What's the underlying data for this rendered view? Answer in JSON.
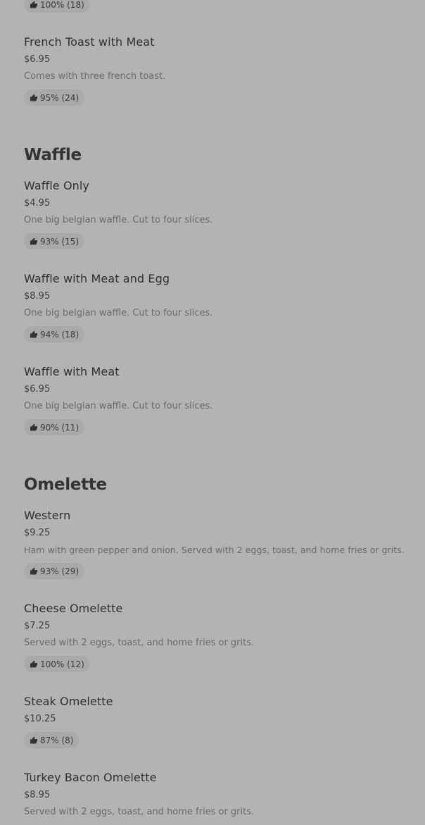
{
  "colors": {
    "background": "#b3b3b3",
    "badge": "#a9a9a9",
    "text": "#2f2f2f",
    "muted": "#6a6a6a"
  },
  "icon": "thumbs-up-icon",
  "top_badge": "100% (18)",
  "items": {
    "french_toast_meat": {
      "name": "French Toast with Meat",
      "price": "$6.95",
      "desc": "Comes with three french toast.",
      "rating": "95% (24)"
    },
    "waffle_only": {
      "name": "Waffle Only",
      "price": "$4.95",
      "desc": "One big belgian waffle. Cut to four slices.",
      "rating": "93% (15)"
    },
    "waffle_meat_egg": {
      "name": "Waffle with Meat and Egg",
      "price": "$8.95",
      "desc": "One big belgian waffle. Cut to four slices.",
      "rating": "94% (18)"
    },
    "waffle_meat": {
      "name": "Waffle with Meat",
      "price": "$6.95",
      "desc": "One big belgian waffle. Cut to four slices.",
      "rating": "90% (11)"
    },
    "western": {
      "name": "Western",
      "price": "$9.25",
      "desc": "Ham with green pepper and onion. Served with 2 eggs, toast, and home fries or grits.",
      "rating": "93% (29)"
    },
    "cheese_omelette": {
      "name": "Cheese Omelette",
      "price": "$7.25",
      "desc": "Served with 2 eggs, toast, and home fries or grits.",
      "rating": "100% (12)"
    },
    "steak_omelette": {
      "name": "Steak Omelette",
      "price": "$10.25",
      "rating": "87% (8)"
    },
    "turkey_bacon_omelette": {
      "name": "Turkey Bacon Omelette",
      "price": "$8.95",
      "desc": "Served with 2 eggs, toast, and home fries or grits."
    }
  },
  "sections": {
    "waffle": "Waffle",
    "omelette": "Omelette"
  }
}
